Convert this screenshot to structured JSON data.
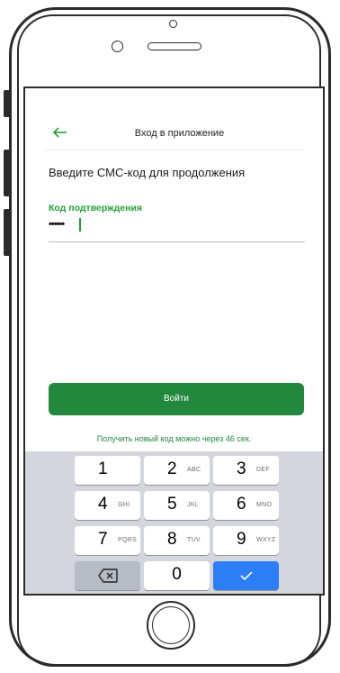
{
  "header": {
    "title": "Вход в приложение",
    "back_icon": "arrow-left-icon"
  },
  "subtitle": "Введите СМС-код для продолжения",
  "code_field": {
    "label": "Код подтверждения",
    "value": "••••••"
  },
  "login_button": {
    "label": "Войти"
  },
  "resend_text": "Получить новый код можно через 46 сек.",
  "keypad": {
    "keys": [
      {
        "digit": "1",
        "letters": ""
      },
      {
        "digit": "2",
        "letters": "ABC"
      },
      {
        "digit": "3",
        "letters": "DEF"
      },
      {
        "digit": "4",
        "letters": "GHI"
      },
      {
        "digit": "5",
        "letters": "JKL"
      },
      {
        "digit": "6",
        "letters": "MNO"
      },
      {
        "digit": "7",
        "letters": "PQRS"
      },
      {
        "digit": "8",
        "letters": "TUV"
      },
      {
        "digit": "9",
        "letters": "WXYZ"
      },
      {
        "digit": "0",
        "letters": ""
      }
    ],
    "delete_icon": "backspace-icon",
    "confirm_icon": "checkmark-icon"
  },
  "colors": {
    "accent": "#21A038",
    "button": "#21883D",
    "keypad_bg": "#D3D6DC",
    "confirm": "#2B7EF6"
  }
}
